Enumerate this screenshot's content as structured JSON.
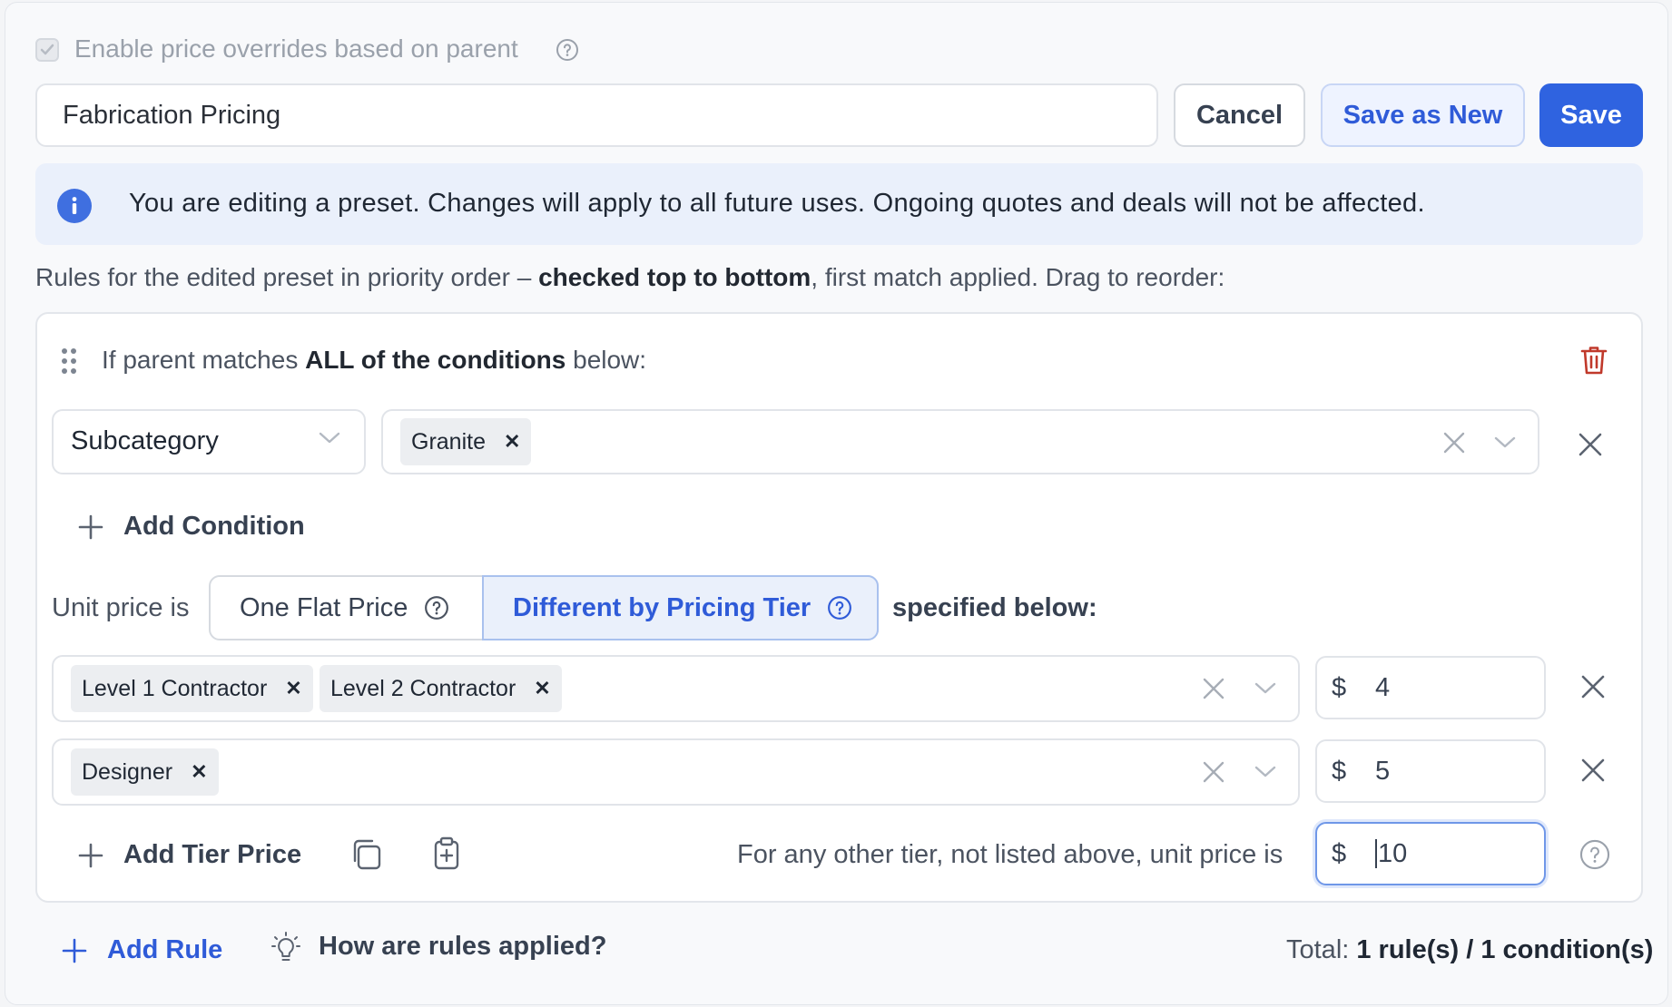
{
  "enable_overrides": {
    "label": "Enable price overrides based on parent",
    "checked": true
  },
  "preset": {
    "name_value": "Fabrication Pricing"
  },
  "actions": {
    "cancel": "Cancel",
    "save_as_new": "Save as New",
    "save": "Save"
  },
  "banner": {
    "text": "You are editing a preset. Changes will apply to all future uses. Ongoing quotes and deals will not be affected."
  },
  "rules_intro": {
    "prefix": "Rules for the edited preset in priority order – ",
    "bold": "checked top to bottom",
    "suffix": ", first match applied. Drag to reorder:"
  },
  "rule": {
    "header_prefix": "If parent matches ",
    "header_bold": "ALL of the conditions",
    "header_suffix": " below:",
    "condition": {
      "field": "Subcategory",
      "values": [
        "Granite"
      ]
    },
    "add_condition": "Add Condition",
    "unit_price_label": "Unit price is",
    "mode_options": [
      "One Flat Price",
      "Different by Pricing Tier"
    ],
    "selected_mode": "Different by Pricing Tier",
    "specified_below": "specified below:",
    "tiers": [
      {
        "tiers": [
          "Level 1 Contractor",
          "Level 2 Contractor"
        ],
        "currency": "$",
        "price": "4"
      },
      {
        "tiers": [
          "Designer"
        ],
        "currency": "$",
        "price": "5"
      }
    ],
    "add_tier_price": "Add Tier Price",
    "other_tier_label": "For any other tier, not listed above, unit price is",
    "other_tier_currency": "$",
    "other_tier_price": "10"
  },
  "footer": {
    "add_rule": "Add Rule",
    "how_rules": "How are rules applied?",
    "total_label": "Total: ",
    "total_value": "1 rule(s) / 1 condition(s)"
  },
  "colors": {
    "primary": "#2f63e0",
    "banner_bg": "#eaf0fb",
    "danger": "#c0392b"
  }
}
